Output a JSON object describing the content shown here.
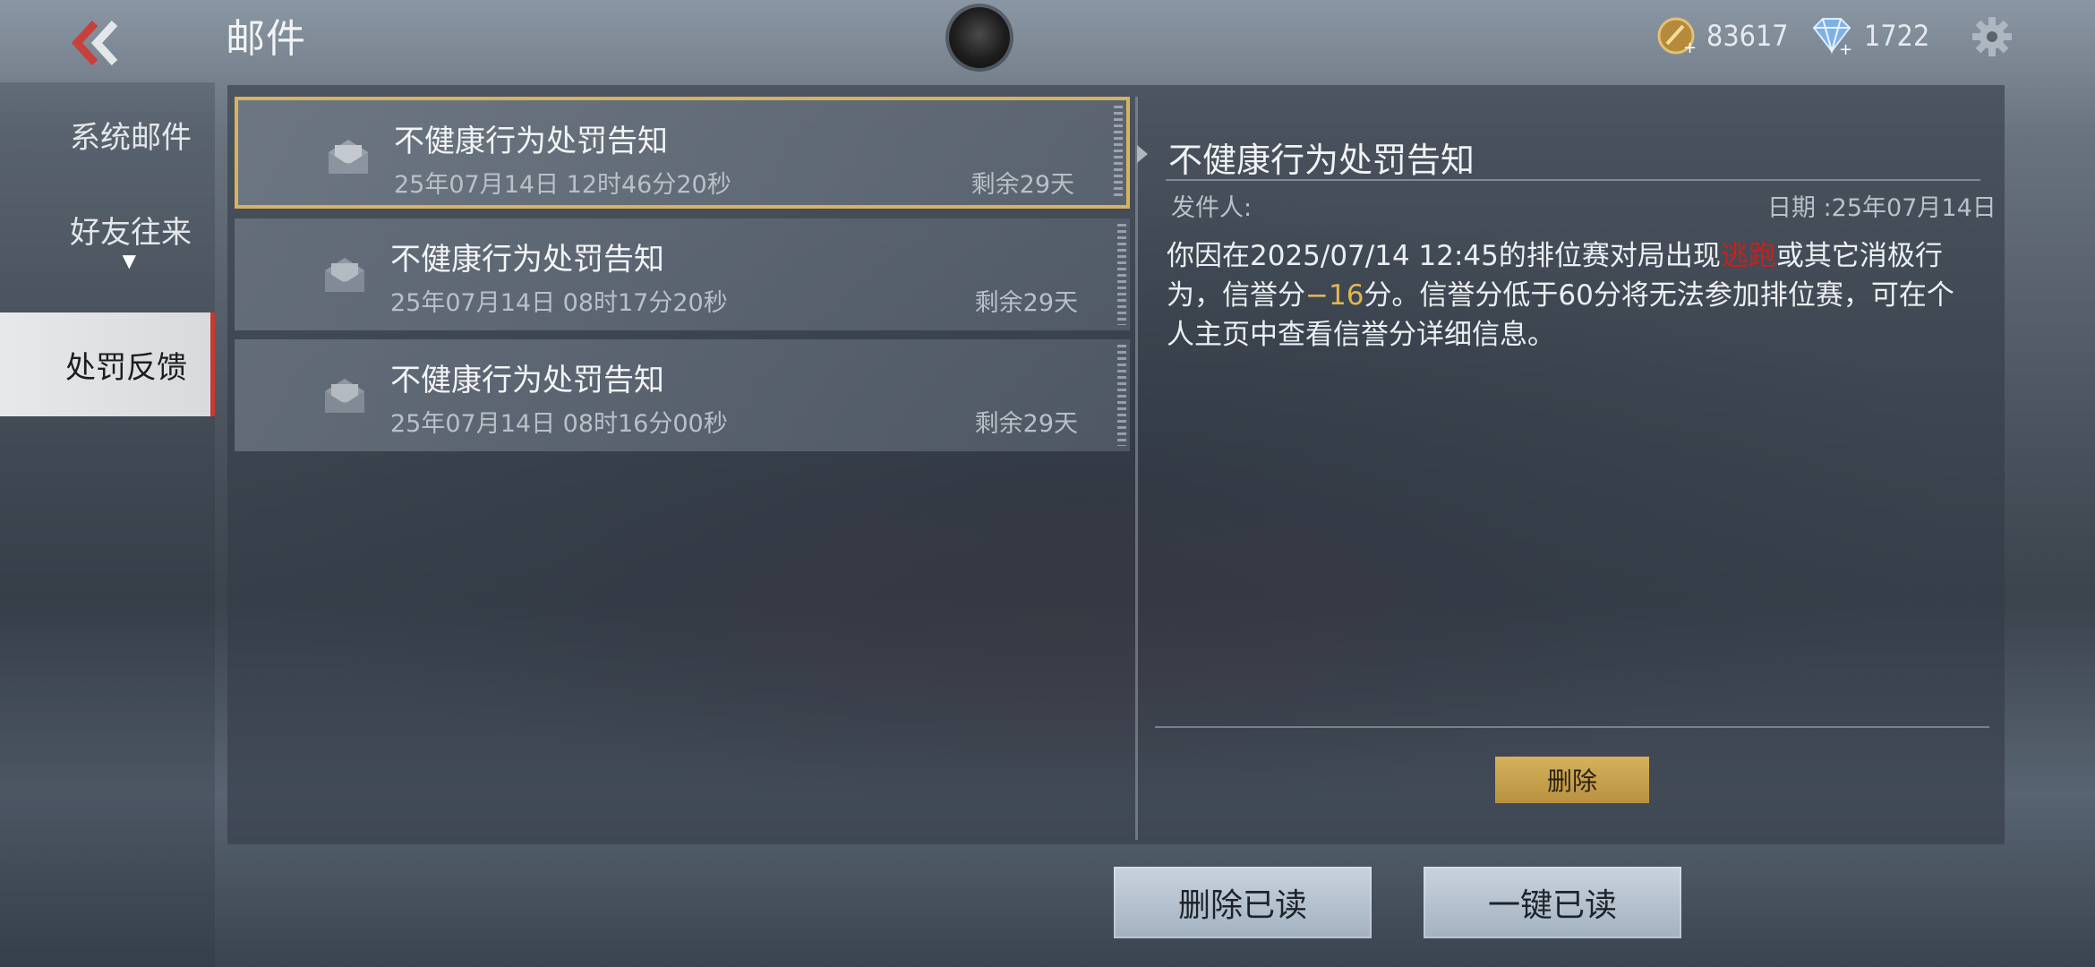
{
  "header": {
    "title": "邮件",
    "gold_amount": "83617",
    "diamond_amount": "1722",
    "icons": {
      "back": "double-chevron-left-icon",
      "gold": "gold-coin-icon",
      "diamond": "diamond-icon",
      "settings": "gear-icon"
    }
  },
  "sidebar": {
    "items": [
      {
        "label": "系统邮件",
        "active": false
      },
      {
        "label": "好友往来",
        "active": false,
        "caret": "▼"
      },
      {
        "label": "处罚反馈",
        "active": true
      }
    ]
  },
  "mail_list": [
    {
      "title": "不健康行为处罚告知",
      "time": "25年07月14日 12时46分20秒",
      "remaining": "剩余29天",
      "selected": true
    },
    {
      "title": "不健康行为处罚告知",
      "time": "25年07月14日 08时17分20秒",
      "remaining": "剩余29天",
      "selected": false
    },
    {
      "title": "不健康行为处罚告知",
      "time": "25年07月14日 08时16分00秒",
      "remaining": "剩余29天",
      "selected": false
    }
  ],
  "detail": {
    "title": "不健康行为处罚告知",
    "sender_label": "发件人:",
    "date_label": "日期 :25年07月14日",
    "body_part1": "你因在2025/07/14 12:45的排位赛对局出现",
    "body_red": "逃跑",
    "body_part2": "或其它消极行为，信誉分",
    "body_gold": "−16",
    "body_part3": "分。信誉分低于60分将无法参加排位赛，可在个人主页中查看信誉分详细信息。",
    "delete_label": "删除"
  },
  "footer": {
    "delete_read_label": "删除已读",
    "mark_all_read_label": "一键已读"
  },
  "colors": {
    "selected_border": "#d8b35e",
    "active_tab_accent": "#c53a34",
    "highlight_red": "#c7211f",
    "highlight_gold": "#e0b652",
    "delete_button": "#c9a24e"
  }
}
